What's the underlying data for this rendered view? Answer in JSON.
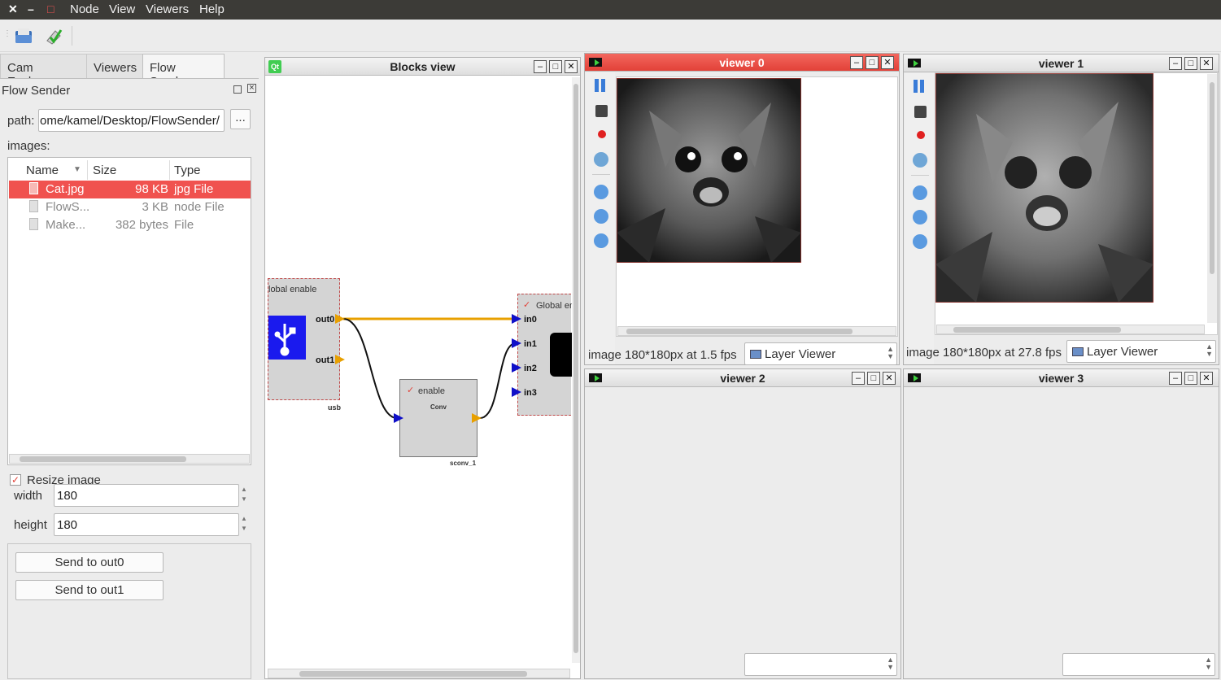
{
  "menubar": {
    "items": [
      "Node",
      "View",
      "Viewers",
      "Help"
    ],
    "close": "✕",
    "minimize": "–",
    "maximize": "□"
  },
  "tabs": [
    "Cam Explorer",
    "Viewers",
    "Flow Sender"
  ],
  "flow_sender": {
    "title": "Flow Sender",
    "path_label": "path:",
    "path_value": "ome/kamel/Desktop/FlowSender/",
    "browse_label": "...",
    "images_label": "images:",
    "columns": [
      "Name",
      "Size",
      "Type"
    ],
    "files": [
      {
        "name": "Cat.jpg",
        "size": "98 KB",
        "type": "jpg File",
        "selected": true
      },
      {
        "name": "FlowS...",
        "size": "3 KB",
        "type": "node File",
        "selected": false
      },
      {
        "name": "Make...",
        "size": "382 bytes",
        "type": "File",
        "selected": false
      }
    ],
    "resize_label": "Resize image",
    "resize_checked": true,
    "width_label": "width",
    "width_value": "180",
    "height_label": "height",
    "height_value": "180",
    "send_out0": "Send to out0",
    "send_out1": "Send to out1"
  },
  "blocks_view": {
    "title": "Blocks view",
    "qt_badge": "Qt",
    "usb_node": {
      "header": "lobal enable",
      "out0": "out0",
      "out1": "out1",
      "name": "usb"
    },
    "conv_node": {
      "enable": "enable",
      "label": "Conv",
      "name": "sconv_1"
    },
    "viewer_node": {
      "header": "Global en",
      "in0": "in0",
      "in1": "in1",
      "in2": "in2",
      "in3": "in3"
    }
  },
  "viewers": [
    {
      "title": "viewer 0",
      "status": "image 180*180px at 1.5 fps",
      "combo": "Layer Viewer",
      "active": true
    },
    {
      "title": "viewer 1",
      "status": "image 180*180px at 27.8 fps",
      "combo": "Layer Viewer",
      "active": false
    },
    {
      "title": "viewer 2",
      "active": false
    },
    {
      "title": "viewer 3",
      "active": false
    }
  ],
  "colors": {
    "selection": "#f0524f",
    "active_title": "#e24138",
    "usb_block": "#1a1aee",
    "wire_orange": "#e8a000",
    "port_blue": "#1010c8"
  }
}
